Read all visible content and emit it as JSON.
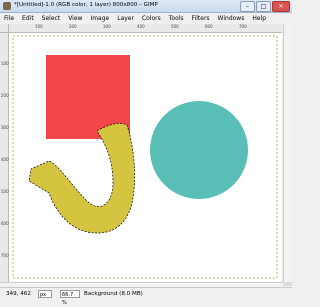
{
  "window": {
    "title": "*[Untitled]-1.0 (RGB color, 1 layer) 800x800 – GIMP",
    "minimize": "–",
    "maximize": "□",
    "close": "✕"
  },
  "menubar": {
    "items": [
      "File",
      "Edit",
      "Select",
      "View",
      "Image",
      "Layer",
      "Colors",
      "Tools",
      "Filters",
      "Windows",
      "Help"
    ]
  },
  "canvas": {
    "square_color": "#f2464a",
    "circle_color": "#59bfb6",
    "stroke_color": "#d5c43f",
    "selection": "marching-ants around yellow stroke"
  },
  "ruler": {
    "top_labels": [
      "100",
      "200",
      "300",
      "400",
      "500",
      "600",
      "700"
    ],
    "left_labels": [
      "100",
      "200",
      "300",
      "400",
      "500",
      "600",
      "700"
    ]
  },
  "status": {
    "coords": "349, 462",
    "unit": "px",
    "zoom": "66.7 %",
    "layer_info": "Background (8.0 MB)"
  }
}
